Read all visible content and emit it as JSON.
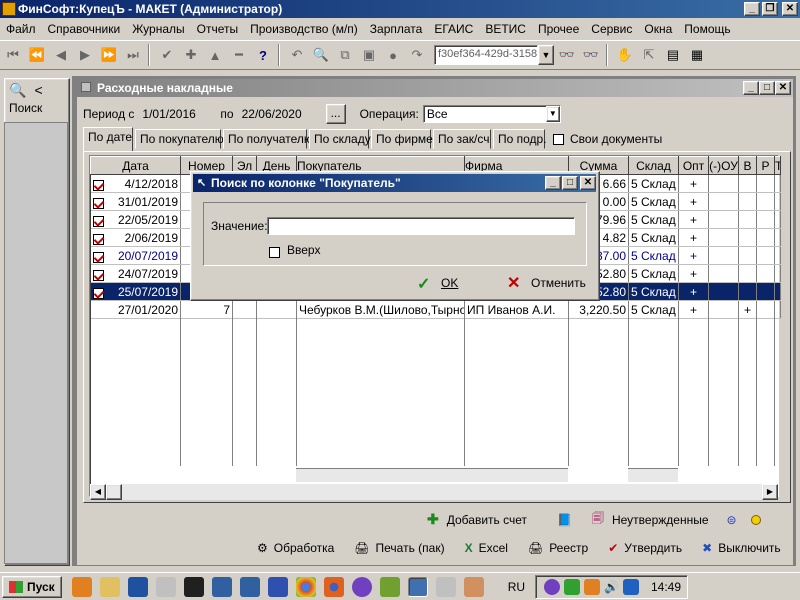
{
  "app": {
    "title": "ФинСофт:КупецЪ - МАКЕТ  (Администратор)"
  },
  "menu": [
    "Файл",
    "Справочники",
    "Журналы",
    "Отчеты",
    "Производство (м/п)",
    "Зарплата",
    "ЕГАИС",
    "ВЕТИС",
    "Прочее",
    "Сервис",
    "Окна",
    "Помощь"
  ],
  "toolbar": {
    "guid": "f30ef364-429d-3158-"
  },
  "left_panel": {
    "search_label": "Поиск",
    "back": "<"
  },
  "document": {
    "title": "Расходные накладные",
    "period_label": "Период с",
    "period_from": "1/01/2016",
    "period_to_label": "по",
    "period_to": "22/06/2020",
    "ellipsis": "...",
    "operation_label": "Операция:",
    "operation_value": "Все",
    "own_docs_label": "Свои документы",
    "tabs": [
      "По дате",
      "По покупателю",
      "По получателю",
      "По складу",
      "По фирме",
      "По зак/сч",
      "По подр."
    ],
    "columns": [
      "Дата",
      "Номер",
      "Эл",
      "День",
      "Покупатель",
      "Фирма",
      "Сумма",
      "Склад",
      "Опт",
      "(-)ОУ",
      "В",
      "Р",
      "Т"
    ],
    "rows": [
      {
        "check": true,
        "date": "4/12/2018",
        "num": "",
        "sum": "6.66",
        "sklad": "5 Склад",
        "opt": "+",
        "v": "",
        "style": ""
      },
      {
        "check": true,
        "date": "31/01/2019",
        "num": "",
        "sum": "0.00",
        "sklad": "5 Склад",
        "opt": "+",
        "v": "",
        "style": ""
      },
      {
        "check": true,
        "date": "22/05/2019",
        "num": "",
        "sum": "79.96",
        "sklad": "5 Склад",
        "opt": "+",
        "v": "",
        "style": ""
      },
      {
        "check": true,
        "date": "2/06/2019",
        "num": "",
        "sum": "4.82",
        "sklad": "5 Склад",
        "opt": "+",
        "v": "",
        "style": ""
      },
      {
        "check": true,
        "date": "20/07/2019",
        "num": "",
        "sum": "37.00",
        "sklad": "5 Склад",
        "opt": "+",
        "v": "",
        "style": "blue"
      },
      {
        "check": true,
        "date": "24/07/2019",
        "num": "",
        "sum": "52.80",
        "sklad": "5 Склад",
        "opt": "+",
        "v": "",
        "style": ""
      },
      {
        "check": true,
        "date": "25/07/2019",
        "num": "",
        "sum": "52.80",
        "sklad": "5 Склад",
        "opt": "+",
        "v": "",
        "style": "sel"
      },
      {
        "check": false,
        "date": "27/01/2020",
        "num": "7",
        "buyer": "Чебурков В.М.(Шилово,Тырново",
        "firm": "ИП Иванов А.И.",
        "sum": "3,220.50",
        "sklad": "5 Склад",
        "opt": "+",
        "v": "+",
        "style": ""
      }
    ],
    "bottom1": {
      "add_invoice": "Добавить счет",
      "unconfirmed": "Неутвержденные"
    },
    "bottom2": {
      "process": "Обработка",
      "print": "Печать (пак)",
      "excel": "Excel",
      "registry": "Реестр",
      "approve": "Утвердить",
      "disable": "Выключить"
    }
  },
  "dialog": {
    "title": "Поиск по колонке \"Покупатель\"",
    "value_label": "Значение:",
    "value": "",
    "up_label": "Вверх",
    "ok": "OK",
    "cancel": "Отменить"
  },
  "taskbar": {
    "start": "Пуск",
    "lang": "RU",
    "time": "14:49"
  }
}
